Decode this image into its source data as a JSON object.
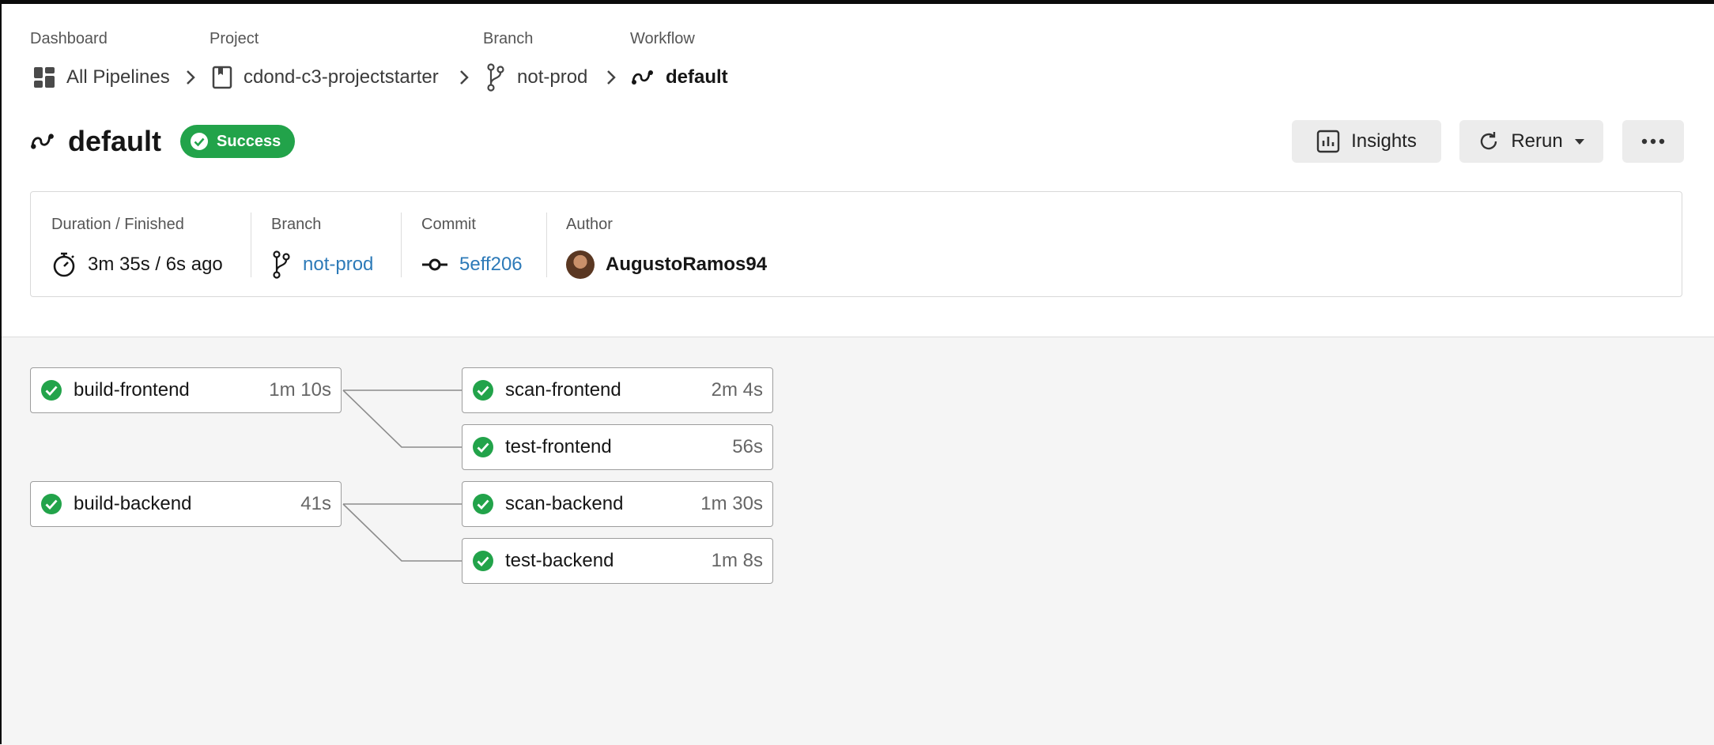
{
  "breadcrumbs": [
    {
      "label": "Dashboard",
      "value": "All Pipelines",
      "icon": "dashboard-icon"
    },
    {
      "label": "Project",
      "value": "cdond-c3-projectstarter",
      "icon": "project-book-icon"
    },
    {
      "label": "Branch",
      "value": "not-prod",
      "icon": "branch-icon"
    },
    {
      "label": "Workflow",
      "value": "default",
      "icon": "workflow-icon"
    }
  ],
  "header": {
    "title": "default",
    "status": "Success",
    "status_color": "#22a34a"
  },
  "actions": {
    "insights_label": "Insights",
    "rerun_label": "Rerun"
  },
  "summary": {
    "duration": {
      "label": "Duration / Finished",
      "value": "3m 35s / 6s ago"
    },
    "branch": {
      "label": "Branch",
      "value": "not-prod"
    },
    "commit": {
      "label": "Commit",
      "value": "5eff206"
    },
    "author": {
      "label": "Author",
      "value": "AugustoRamos94"
    },
    "link_color": "#2d7ab8"
  },
  "jobs": [
    {
      "name": "build-frontend",
      "duration": "1m 10s",
      "status": "success"
    },
    {
      "name": "scan-frontend",
      "duration": "2m 4s",
      "status": "success"
    },
    {
      "name": "test-frontend",
      "duration": "56s",
      "status": "success"
    },
    {
      "name": "build-backend",
      "duration": "41s",
      "status": "success"
    },
    {
      "name": "scan-backend",
      "duration": "1m 30s",
      "status": "success"
    },
    {
      "name": "test-backend",
      "duration": "1m 8s",
      "status": "success"
    }
  ]
}
